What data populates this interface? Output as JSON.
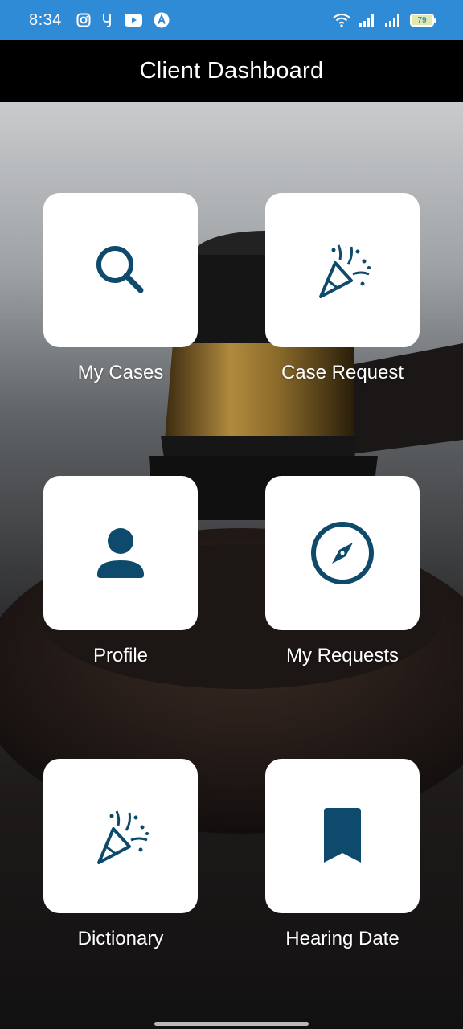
{
  "status_bar": {
    "time": "8:34",
    "battery": "79",
    "icons": [
      "instagram-icon",
      "app-y-icon",
      "youtube-icon",
      "arrow-app-icon",
      "wifi-icon",
      "signal-icon",
      "signal-icon",
      "battery-icon"
    ]
  },
  "header": {
    "title": "Client Dashboard"
  },
  "tiles": [
    {
      "label": "My Cases",
      "icon": "search-icon"
    },
    {
      "label": "Case Request",
      "icon": "party-popper-icon"
    },
    {
      "label": "Profile",
      "icon": "person-icon"
    },
    {
      "label": "My Requests",
      "icon": "compass-icon"
    },
    {
      "label": "Dictionary",
      "icon": "party-popper-icon"
    },
    {
      "label": "Hearing Date",
      "icon": "bookmark-icon"
    }
  ],
  "colors": {
    "status_bar": "#2f8bd6",
    "app_bar": "#000000",
    "icon": "#0d4a6b",
    "tile_bg": "#ffffff"
  }
}
